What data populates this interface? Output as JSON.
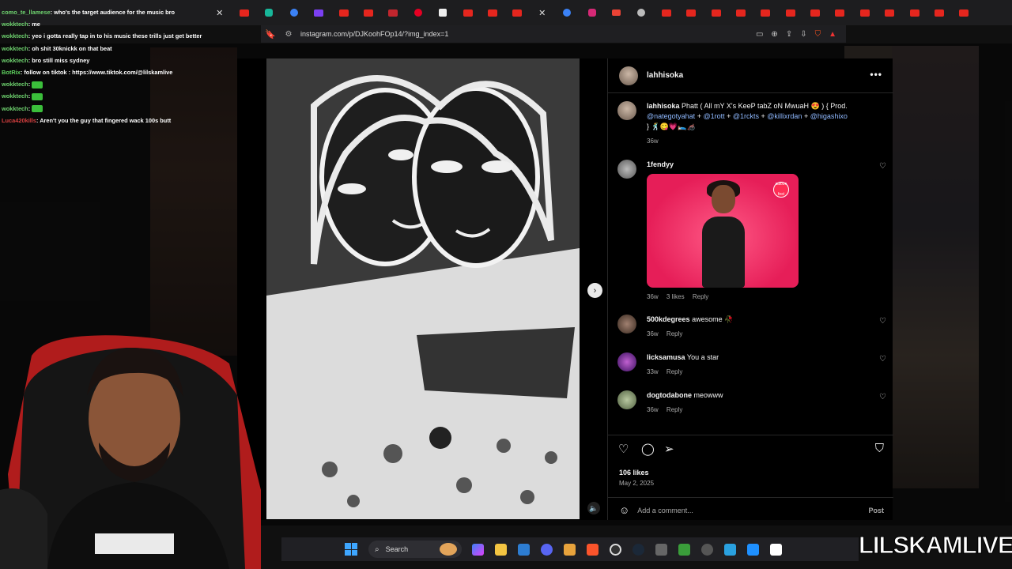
{
  "browser": {
    "url": "instagram.com/p/DJKoohFOp14/?img_index=1"
  },
  "chat": [
    {
      "user": "como_te_llamese",
      "message": "who's the target audience for the music bro",
      "color": "name",
      "emote": false
    },
    {
      "user": "wokktech",
      "message": "me",
      "color": "name",
      "emote": false
    },
    {
      "user": "wokktech",
      "message": "yeo i gotta really tap in to his music these trills just get better",
      "color": "name",
      "emote": false
    },
    {
      "user": "wokktech",
      "message": "oh shit 30knickk on that beat",
      "color": "name",
      "emote": false
    },
    {
      "user": "wokktech",
      "message": "bro still miss sydney",
      "color": "name",
      "emote": false
    },
    {
      "user": "BotRix",
      "message": "follow on tiktok : https://www.tiktok.com/@lilskamlive",
      "color": "bot",
      "emote": false
    },
    {
      "user": "wokktech",
      "message": "",
      "color": "name",
      "emote": true
    },
    {
      "user": "wokktech",
      "message": "",
      "color": "name",
      "emote": true
    },
    {
      "user": "wokktech",
      "message": "",
      "color": "name",
      "emote": true
    },
    {
      "user": "Luca420kills",
      "message": "Aren't you the guy that fingered wack 100s butt",
      "color": "red",
      "emote": false
    }
  ],
  "post": {
    "author": "lahhisoka",
    "caption": {
      "user": "lahhisoka",
      "text": "Phatt ( All mY X's KeeP tabZ oN MwuaH 😍 ) { Prod.",
      "tags": [
        "@nategotyahat",
        "@1rott",
        "@1rckts",
        "@killixrdan",
        "@higashixo"
      ],
      "tail": "} 🕺😋💗🛌🏾🦽",
      "time": "36w"
    },
    "comments": [
      {
        "user": "1fendyy",
        "text": "",
        "time": "36w",
        "likes": "3 likes",
        "reply": "Reply",
        "gif": true,
        "gif_logo": "saloon fest"
      },
      {
        "user": "500kdegrees",
        "text": "awesome 🥀",
        "time": "36w",
        "likes": "",
        "reply": "Reply",
        "gif": false
      },
      {
        "user": "licksamusa",
        "text": "You a star",
        "time": "33w",
        "likes": "",
        "reply": "Reply",
        "gif": false
      },
      {
        "user": "dogtodabone",
        "text": "meowww",
        "time": "36w",
        "likes": "",
        "reply": "Reply",
        "gif": false
      }
    ],
    "likes": "106 likes",
    "date": "May 2, 2025",
    "add_comment_placeholder": "Add a comment...",
    "post_label": "Post"
  },
  "taskbar": {
    "search_label": "Search"
  },
  "watermark": "LILSKAMLIVE"
}
